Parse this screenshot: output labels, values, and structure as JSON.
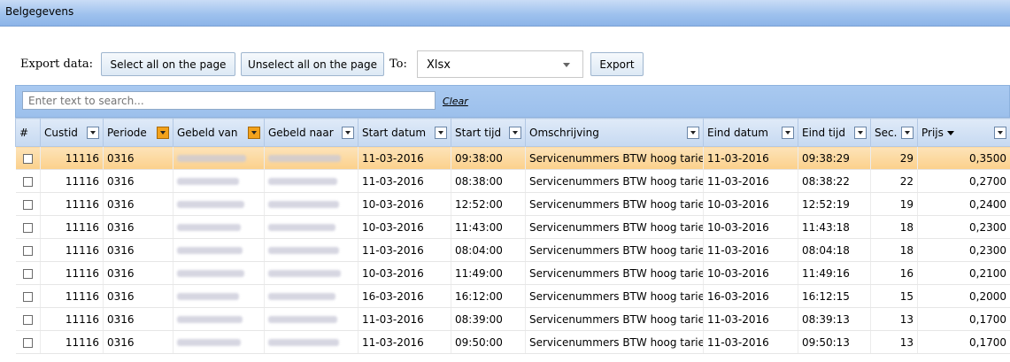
{
  "window": {
    "title": "Belgegevens"
  },
  "export": {
    "label": "Export data:",
    "select_all": "Select all on the page",
    "unselect_all": "Unselect all on the page",
    "to_label": "To:",
    "format_value": "Xlsx",
    "export_button": "Export"
  },
  "grid": {
    "search_placeholder": "Enter text to search...",
    "clear_label": "Clear",
    "columns": [
      {
        "label": "#",
        "filter": false,
        "active": false
      },
      {
        "label": "Custid",
        "filter": true,
        "active": false
      },
      {
        "label": "Periode",
        "filter": true,
        "active": true
      },
      {
        "label": "Gebeld van",
        "filter": true,
        "active": true
      },
      {
        "label": "Gebeld naar",
        "filter": true,
        "active": false
      },
      {
        "label": "Start datum",
        "filter": true,
        "active": false
      },
      {
        "label": "Start tijd",
        "filter": true,
        "active": false
      },
      {
        "label": "Omschrijving",
        "filter": true,
        "active": false
      },
      {
        "label": "Eind datum",
        "filter": true,
        "active": false
      },
      {
        "label": "Eind tijd",
        "filter": true,
        "active": false
      },
      {
        "label": "Sec.",
        "filter": true,
        "active": false
      },
      {
        "label": "Prijs",
        "filter": true,
        "active": false,
        "sorted": "desc"
      }
    ],
    "rows": [
      {
        "custid": "11116",
        "periode": "0316",
        "start_datum": "11-03-2016",
        "start_tijd": "09:38:00",
        "omschrijving": "Servicenummers BTW hoog tarief",
        "eind_datum": "11-03-2016",
        "eind_tijd": "09:38:29",
        "sec": "29",
        "prijs": "0,3500"
      },
      {
        "custid": "11116",
        "periode": "0316",
        "start_datum": "11-03-2016",
        "start_tijd": "08:38:00",
        "omschrijving": "Servicenummers BTW hoog tarief",
        "eind_datum": "11-03-2016",
        "eind_tijd": "08:38:22",
        "sec": "22",
        "prijs": "0,2700"
      },
      {
        "custid": "11116",
        "periode": "0316",
        "start_datum": "10-03-2016",
        "start_tijd": "12:52:00",
        "omschrijving": "Servicenummers BTW hoog tarief",
        "eind_datum": "10-03-2016",
        "eind_tijd": "12:52:19",
        "sec": "19",
        "prijs": "0,2400"
      },
      {
        "custid": "11116",
        "periode": "0316",
        "start_datum": "10-03-2016",
        "start_tijd": "11:43:00",
        "omschrijving": "Servicenummers BTW hoog tarief",
        "eind_datum": "10-03-2016",
        "eind_tijd": "11:43:18",
        "sec": "18",
        "prijs": "0,2300"
      },
      {
        "custid": "11116",
        "periode": "0316",
        "start_datum": "11-03-2016",
        "start_tijd": "08:04:00",
        "omschrijving": "Servicenummers BTW hoog tarief",
        "eind_datum": "11-03-2016",
        "eind_tijd": "08:04:18",
        "sec": "18",
        "prijs": "0,2300"
      },
      {
        "custid": "11116",
        "periode": "0316",
        "start_datum": "10-03-2016",
        "start_tijd": "11:49:00",
        "omschrijving": "Servicenummers BTW hoog tarief",
        "eind_datum": "10-03-2016",
        "eind_tijd": "11:49:16",
        "sec": "16",
        "prijs": "0,2100"
      },
      {
        "custid": "11116",
        "periode": "0316",
        "start_datum": "16-03-2016",
        "start_tijd": "16:12:00",
        "omschrijving": "Servicenummers BTW hoog tarief",
        "eind_datum": "16-03-2016",
        "eind_tijd": "16:12:15",
        "sec": "15",
        "prijs": "0,2000"
      },
      {
        "custid": "11116",
        "periode": "0316",
        "start_datum": "11-03-2016",
        "start_tijd": "08:39:00",
        "omschrijving": "Servicenummers BTW hoog tarief",
        "eind_datum": "11-03-2016",
        "eind_tijd": "08:39:13",
        "sec": "13",
        "prijs": "0,1700"
      },
      {
        "custid": "11116",
        "periode": "0316",
        "start_datum": "11-03-2016",
        "start_tijd": "09:50:00",
        "omschrijving": "Servicenummers BTW hoog tarief",
        "eind_datum": "11-03-2016",
        "eind_tijd": "09:50:13",
        "sec": "13",
        "prijs": "0,1700"
      }
    ]
  }
}
